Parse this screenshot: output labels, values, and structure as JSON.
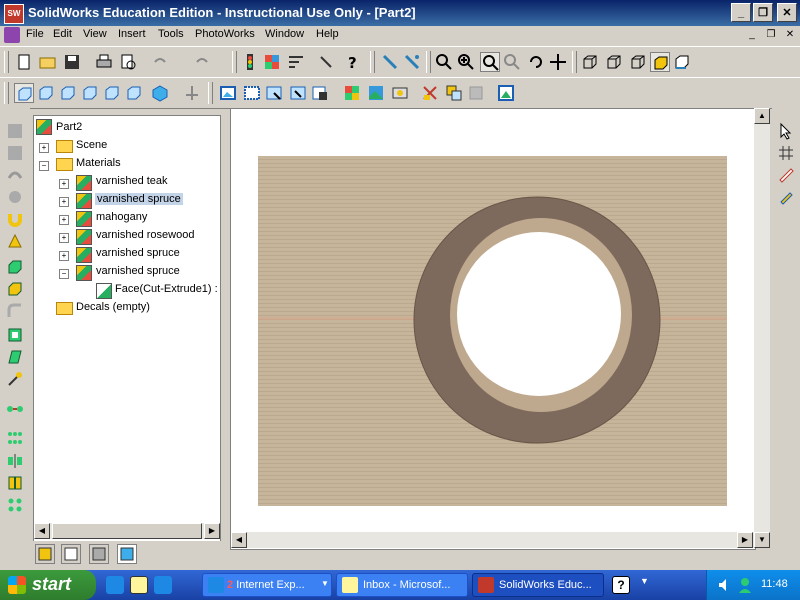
{
  "window": {
    "title": "SolidWorks Education Edition - Instructional Use Only - [Part2]",
    "app_icon": "SW"
  },
  "menu": {
    "items": [
      "File",
      "Edit",
      "View",
      "Insert",
      "Tools",
      "PhotoWorks",
      "Window",
      "Help"
    ]
  },
  "tree": {
    "root": "Part2",
    "scene": "Scene",
    "materials": "Materials",
    "material_items": [
      "varnished teak",
      "varnished spruce",
      "mahogany",
      "varnished rosewood",
      "varnished spruce",
      "varnished spruce"
    ],
    "face": "Face(Cut-Extrude1) :",
    "decals": "Decals (empty)"
  },
  "taskbar": {
    "start": "start",
    "tasks": [
      {
        "count": "2",
        "label": "Internet Exp..."
      },
      {
        "label": "Inbox - Microsof..."
      },
      {
        "label": "SolidWorks Educ..."
      }
    ],
    "clock": "11:48"
  },
  "colors": {
    "wood": "#c7b59b",
    "ring_red": "#a8383f",
    "ring_shadow": "#7e6a5c",
    "inner_rim": "#bfa98e"
  }
}
